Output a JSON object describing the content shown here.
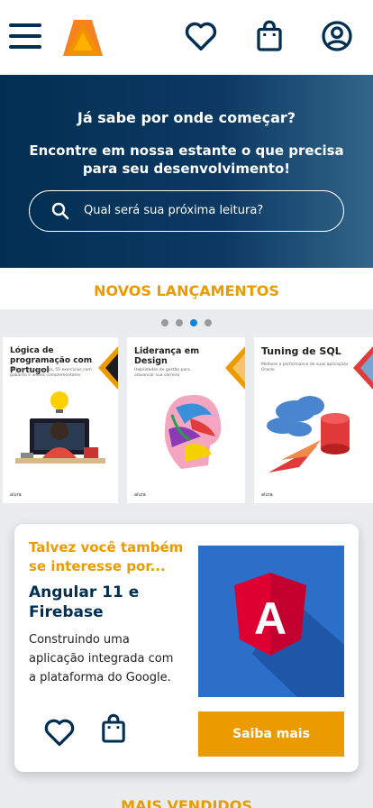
{
  "header": {
    "menu_icon": "hamburger-menu-icon",
    "logo_icon": "alura-books-logo-icon",
    "icons": [
      "heart-icon",
      "shopping-bag-icon",
      "user-profile-icon"
    ]
  },
  "hero": {
    "title": "Já sabe por onde começar?",
    "subtitle": "Encontre em nossa estante o que precisa para seu desenvolvimento!",
    "search_placeholder": "Qual será sua próxima leitura?"
  },
  "new_releases": {
    "title": "NOVOS LANÇAMENTOS",
    "active_dot": 3,
    "dot_count": 4,
    "books": [
      {
        "title": "Lógica de programação com Portugol",
        "subtitle": "Mais de 80 exemplos, 55 exercícios com gabarito e vídeos complementares",
        "footer": "alura"
      },
      {
        "title": "Liderança em Design",
        "subtitle": "Habilidades de gestão para alavancar sua carreira",
        "footer": "alura"
      },
      {
        "title": "Tuning de SQL",
        "subtitle": "Melhore a performance de suas aplicações Oracle",
        "footer": "alura"
      }
    ]
  },
  "recommendation": {
    "eyebrow": "Talvez você também se interesse por...",
    "title": "Angular 11 e Firebase",
    "description": "Construindo uma aplicação integrada com a plataforma do Google.",
    "button": "Saiba mais",
    "image_letter": "A"
  },
  "best_sellers": {
    "title": "MAIS VENDIDOS"
  },
  "colors": {
    "primary": "#002f52",
    "accent": "#eb9b00",
    "active_dot": "#0d86d7"
  }
}
